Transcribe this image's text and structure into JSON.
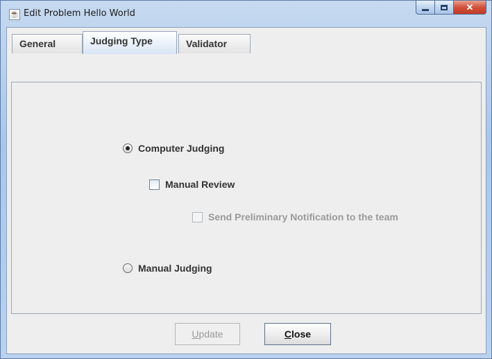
{
  "window": {
    "title": "Edit Problem Hello World",
    "controls": {
      "minimize": "minimize",
      "maximize": "maximize",
      "close": "✕"
    }
  },
  "tabs": [
    {
      "label": "General",
      "active": false
    },
    {
      "label": "Judging Type",
      "active": true
    },
    {
      "label": "Validator",
      "active": false
    }
  ],
  "judging": {
    "computer_judging": {
      "label": "Computer Judging",
      "selected": true
    },
    "manual_review": {
      "label": "Manual Review",
      "checked": false
    },
    "send_preliminary": {
      "label": "Send Preliminary Notification to the team",
      "checked": false,
      "enabled": false
    },
    "manual_judging": {
      "label": "Manual Judging",
      "selected": false
    }
  },
  "buttons": {
    "update": {
      "label_mnemonic": "U",
      "label_rest": "pdate",
      "enabled": false
    },
    "close": {
      "label_mnemonic": "C",
      "label_rest": "lose",
      "enabled": true
    }
  }
}
